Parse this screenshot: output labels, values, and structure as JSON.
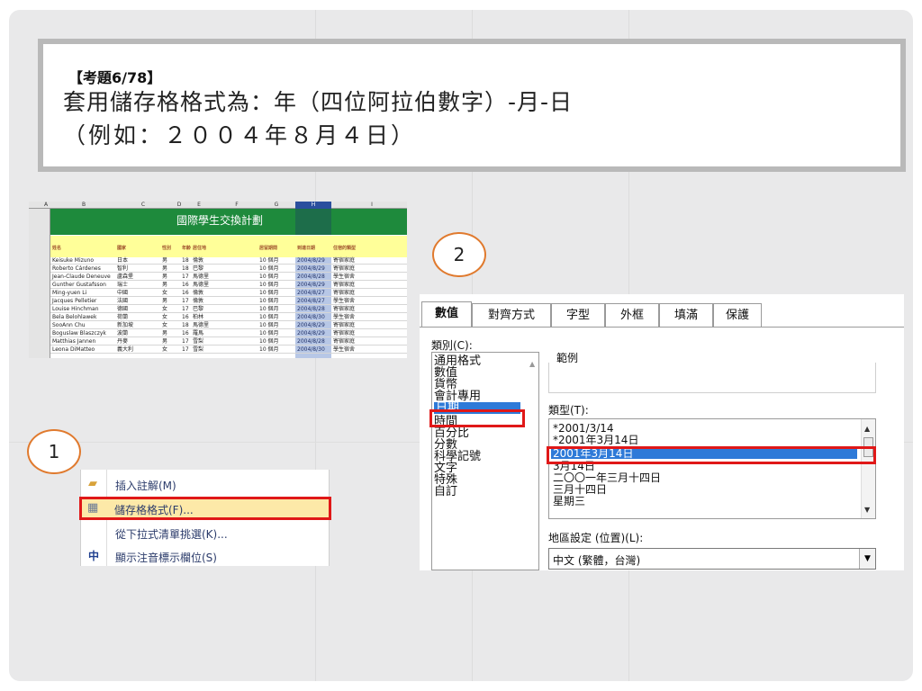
{
  "title": {
    "label": "【考題6/78】",
    "line1": "套用儲存格格式為：年（四位阿拉伯數字）-月-日",
    "line2": "（例如：２００４年８月４日）"
  },
  "spreadsheet": {
    "columns": [
      "A",
      "B",
      "C",
      "D",
      "E",
      "F",
      "G",
      "H",
      "I"
    ],
    "banner_title": "國際學生交換計劃",
    "headers": [
      "姓名",
      "國家",
      "性別",
      "年齡",
      "居住地",
      "居留期間",
      "到達日期",
      "住宿的類型"
    ],
    "rows": [
      [
        "Keisuke Mizuno",
        "日本",
        "男",
        "18",
        "倫敦",
        "10 個月",
        "2004/8/29",
        "寄宿家庭"
      ],
      [
        "Roberto Cárdenes",
        "智利",
        "男",
        "18",
        "巴黎",
        "10 個月",
        "2004/8/29",
        "寄宿家庭"
      ],
      [
        "Jean-Claude Deneuve",
        "盧森堡",
        "男",
        "17",
        "馬德里",
        "10 個月",
        "2004/8/28",
        "學生宿舍"
      ],
      [
        "Gunther Gustafsson",
        "瑞士",
        "男",
        "16",
        "馬德里",
        "10 個月",
        "2004/8/29",
        "寄宿家庭"
      ],
      [
        "Ming-yuen Li",
        "中國",
        "女",
        "16",
        "倫敦",
        "10 個月",
        "2004/8/27",
        "寄宿家庭"
      ],
      [
        "Jacques Pelletier",
        "法國",
        "男",
        "17",
        "倫敦",
        "10 個月",
        "2004/8/27",
        "學生宿舍"
      ],
      [
        "Louise Hinchman",
        "德國",
        "女",
        "17",
        "巴黎",
        "10 個月",
        "2004/8/28",
        "寄宿家庭"
      ],
      [
        "Bela Belohlawek",
        "荷蘭",
        "女",
        "16",
        "柏林",
        "10 個月",
        "2004/8/30",
        "學生宿舍"
      ],
      [
        "SooAnn Chu",
        "新加坡",
        "女",
        "18",
        "馬德里",
        "10 個月",
        "2004/8/29",
        "寄宿家庭"
      ],
      [
        "Boguslaw Blaszczyk",
        "波蘭",
        "男",
        "16",
        "羅馬",
        "10 個月",
        "2004/8/29",
        "寄宿家庭"
      ],
      [
        "Matthias Jannen",
        "丹麥",
        "男",
        "17",
        "雪梨",
        "10 個月",
        "2004/8/28",
        "寄宿家庭"
      ],
      [
        "Leona DiMatteo",
        "義大利",
        "女",
        "17",
        "雪梨",
        "10 個月",
        "2004/8/30",
        "學生宿舍"
      ]
    ]
  },
  "steps": {
    "step1": "1",
    "step2": "2"
  },
  "context_menu": {
    "items": [
      {
        "label": "插入註解(M)",
        "icon": "comment-icon"
      },
      {
        "label": "儲存格格式(F)...",
        "icon": "format-cells-icon"
      },
      {
        "label": "從下拉式清單挑選(K)...",
        "icon": ""
      },
      {
        "label": "顯示注音標示欄位(S)",
        "icon": "phonetic-icon"
      }
    ]
  },
  "format_dialog": {
    "tabs": [
      "數值",
      "對齊方式",
      "字型",
      "外框",
      "填滿",
      "保護"
    ],
    "category_label": "類別(C):",
    "categories": [
      "通用格式",
      "數值",
      "貨幣",
      "會計專用",
      "日期",
      "時間",
      "百分比",
      "分數",
      "科學記號",
      "文字",
      "特殊",
      "自訂"
    ],
    "selected_category": "日期",
    "sample_label": "範例",
    "type_label": "類型(T):",
    "types": [
      "*2001/3/14",
      "*2001年3月14日",
      "2001年3月14日",
      "3月14日",
      "二〇〇一年三月十四日",
      "三月十四日",
      "星期三"
    ],
    "selected_type": "2001年3月14日",
    "locale_label": "地區設定 (位置)(L):",
    "locale_value": "中文 (繁體，台灣)"
  },
  "colors": {
    "accent_red": "#e01818",
    "selection_blue": "#2e7ad8",
    "banner_green": "#1e8a3c",
    "badge_orange": "#e07a2e"
  }
}
